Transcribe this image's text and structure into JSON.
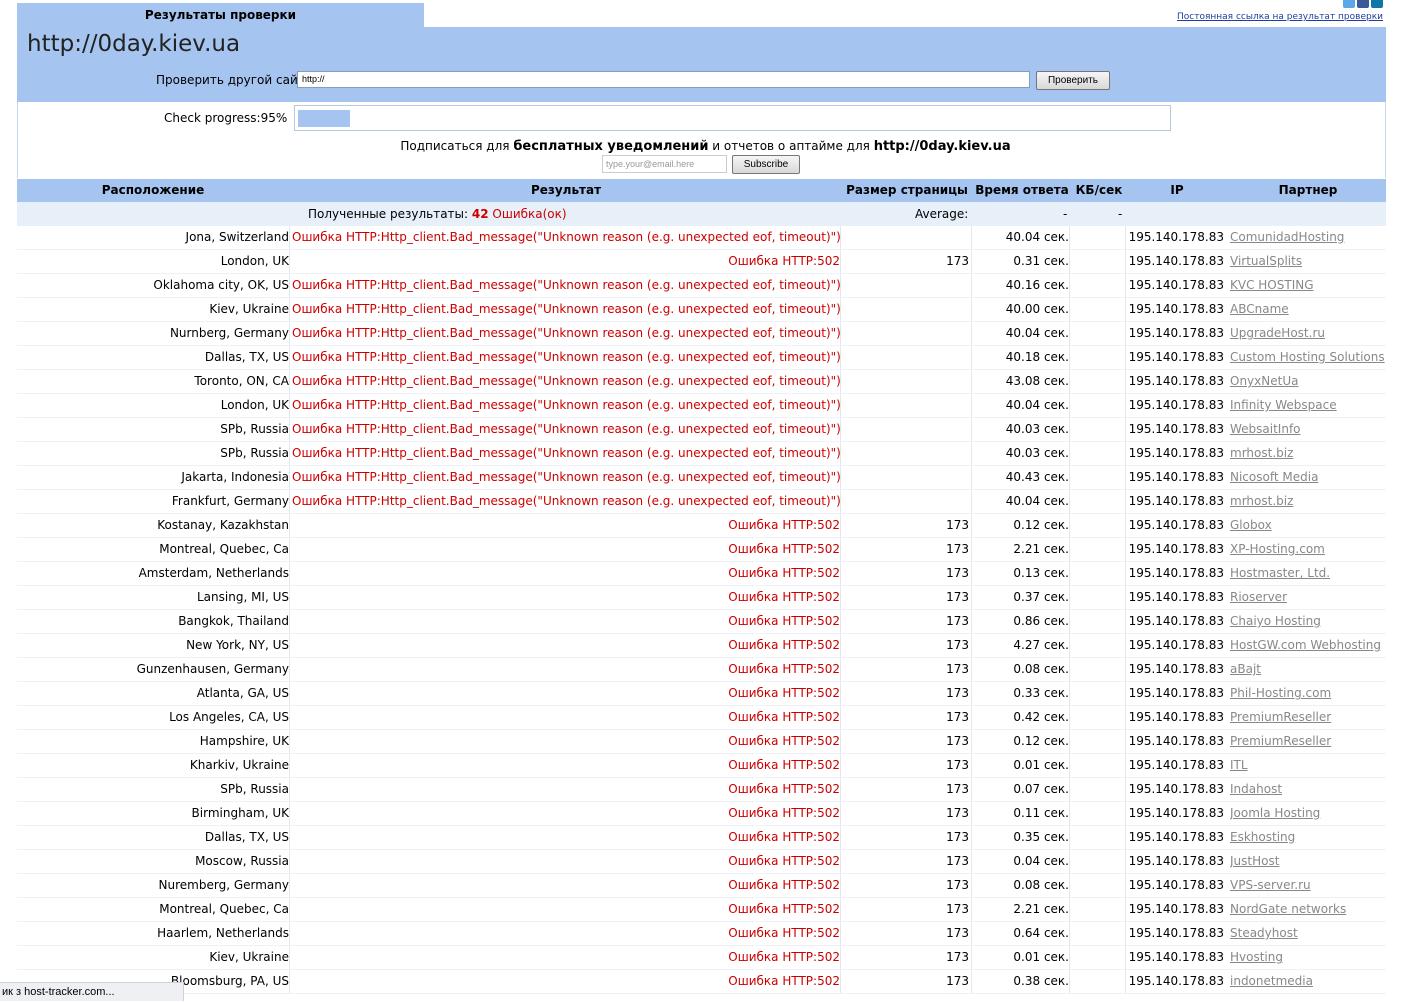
{
  "social": {
    "colors": [
      "#5aa9e6",
      "#3b5998",
      "#0e76a8"
    ]
  },
  "permalink_label": "Постоянная ссылка на результат проверки",
  "tab_label": "Результаты проверки",
  "site_title": "http://0day.kiev.ua",
  "check_label": "Проверить другой сайт:",
  "url_value": "http://",
  "check_button": "Проверить",
  "progress": {
    "label": "Check progress:95%",
    "percent": 95
  },
  "subscribe": {
    "text1": "Подписаться для ",
    "bold1": "бесплатных уведомлений",
    "text2": " и отчетов о аптайме для ",
    "bold2": "http://0day.kiev.ua",
    "email_placeholder": "type.your@email.here",
    "button": "Subscribe"
  },
  "columns": {
    "location": "Расположение",
    "result": "Результат",
    "size": "Размер страницы",
    "time": "Время ответа",
    "kb": "КБ/сек",
    "ip": "IP",
    "partner": "Партнер"
  },
  "summary": {
    "label": "Полученные результаты: ",
    "count": "42",
    "errors": " Ошибка(ок)",
    "average_label": "Average:",
    "avg_time": "-",
    "avg_kb": "-"
  },
  "rows": [
    {
      "loc": "Jona, Switzerland",
      "res": "Ошибка HTTP:Http_client.Bad_message(\"Unknown reason (e.g. unexpected eof, timeout)\")",
      "size": "",
      "time": "40.04 сек.",
      "ip": "195.140.178.83",
      "partner": "ComunidadHosting"
    },
    {
      "loc": "London, UK",
      "res": "Ошибка HTTP:502",
      "size": "173",
      "time": "0.31 сек.",
      "ip": "195.140.178.83",
      "partner": "VirtualSplits"
    },
    {
      "loc": "Oklahoma city, OK, US",
      "res": "Ошибка HTTP:Http_client.Bad_message(\"Unknown reason (e.g. unexpected eof, timeout)\")",
      "size": "",
      "time": "40.16 сек.",
      "ip": "195.140.178.83",
      "partner": "KVC HOSTING"
    },
    {
      "loc": "Kiev, Ukraine",
      "res": "Ошибка HTTP:Http_client.Bad_message(\"Unknown reason (e.g. unexpected eof, timeout)\")",
      "size": "",
      "time": "40.00 сек.",
      "ip": "195.140.178.83",
      "partner": "ABCname"
    },
    {
      "loc": "Nurnberg, Germany",
      "res": "Ошибка HTTP:Http_client.Bad_message(\"Unknown reason (e.g. unexpected eof, timeout)\")",
      "size": "",
      "time": "40.04 сек.",
      "ip": "195.140.178.83",
      "partner": "UpgradeHost.ru"
    },
    {
      "loc": "Dallas, TX, US",
      "res": "Ошибка HTTP:Http_client.Bad_message(\"Unknown reason (e.g. unexpected eof, timeout)\")",
      "size": "",
      "time": "40.18 сек.",
      "ip": "195.140.178.83",
      "partner": "Custom Hosting Solutions"
    },
    {
      "loc": "Toronto, ON, CA",
      "res": "Ошибка HTTP:Http_client.Bad_message(\"Unknown reason (e.g. unexpected eof, timeout)\")",
      "size": "",
      "time": "43.08 сек.",
      "ip": "195.140.178.83",
      "partner": "OnyxNetUa"
    },
    {
      "loc": "London, UK",
      "res": "Ошибка HTTP:Http_client.Bad_message(\"Unknown reason (e.g. unexpected eof, timeout)\")",
      "size": "",
      "time": "40.04 сек.",
      "ip": "195.140.178.83",
      "partner": "Infinity Webspace"
    },
    {
      "loc": "SPb, Russia",
      "res": "Ошибка HTTP:Http_client.Bad_message(\"Unknown reason (e.g. unexpected eof, timeout)\")",
      "size": "",
      "time": "40.03 сек.",
      "ip": "195.140.178.83",
      "partner": "WebsaitInfo"
    },
    {
      "loc": "SPb, Russia",
      "res": "Ошибка HTTP:Http_client.Bad_message(\"Unknown reason (e.g. unexpected eof, timeout)\")",
      "size": "",
      "time": "40.03 сек.",
      "ip": "195.140.178.83",
      "partner": "mrhost.biz"
    },
    {
      "loc": "Jakarta, Indonesia",
      "res": "Ошибка HTTP:Http_client.Bad_message(\"Unknown reason (e.g. unexpected eof, timeout)\")",
      "size": "",
      "time": "40.43 сек.",
      "ip": "195.140.178.83",
      "partner": "Nicosoft Media"
    },
    {
      "loc": "Frankfurt, Germany",
      "res": "Ошибка HTTP:Http_client.Bad_message(\"Unknown reason (e.g. unexpected eof, timeout)\")",
      "size": "",
      "time": "40.04 сек.",
      "ip": "195.140.178.83",
      "partner": "mrhost.biz"
    },
    {
      "loc": "Kostanay, Kazakhstan",
      "res": "Ошибка HTTP:502",
      "size": "173",
      "time": "0.12 сек.",
      "ip": "195.140.178.83",
      "partner": "Globox"
    },
    {
      "loc": "Montreal, Quebec, Ca",
      "res": "Ошибка HTTP:502",
      "size": "173",
      "time": "2.21 сек.",
      "ip": "195.140.178.83",
      "partner": "XP-Hosting.com"
    },
    {
      "loc": "Amsterdam, Netherlands",
      "res": "Ошибка HTTP:502",
      "size": "173",
      "time": "0.13 сек.",
      "ip": "195.140.178.83",
      "partner": "Hostmaster, Ltd."
    },
    {
      "loc": "Lansing, MI, US",
      "res": "Ошибка HTTP:502",
      "size": "173",
      "time": "0.37 сек.",
      "ip": "195.140.178.83",
      "partner": "Rioserver"
    },
    {
      "loc": "Bangkok, Thailand",
      "res": "Ошибка HTTP:502",
      "size": "173",
      "time": "0.86 сек.",
      "ip": "195.140.178.83",
      "partner": "Chaiyo Hosting"
    },
    {
      "loc": "New York, NY, US",
      "res": "Ошибка HTTP:502",
      "size": "173",
      "time": "4.27 сек.",
      "ip": "195.140.178.83",
      "partner": "HostGW.com Webhosting"
    },
    {
      "loc": "Gunzenhausen, Germany",
      "res": "Ошибка HTTP:502",
      "size": "173",
      "time": "0.08 сек.",
      "ip": "195.140.178.83",
      "partner": "aBajt"
    },
    {
      "loc": "Atlanta, GA, US",
      "res": "Ошибка HTTP:502",
      "size": "173",
      "time": "0.33 сек.",
      "ip": "195.140.178.83",
      "partner": "Phil-Hosting.com"
    },
    {
      "loc": "Los Angeles, CA, US",
      "res": "Ошибка HTTP:502",
      "size": "173",
      "time": "0.42 сек.",
      "ip": "195.140.178.83",
      "partner": "PremiumReseller"
    },
    {
      "loc": "Hampshire, UK",
      "res": "Ошибка HTTP:502",
      "size": "173",
      "time": "0.12 сек.",
      "ip": "195.140.178.83",
      "partner": "PremiumReseller"
    },
    {
      "loc": "Kharkiv, Ukraine",
      "res": "Ошибка HTTP:502",
      "size": "173",
      "time": "0.01 сек.",
      "ip": "195.140.178.83",
      "partner": "ITL"
    },
    {
      "loc": "SPb, Russia",
      "res": "Ошибка HTTP:502",
      "size": "173",
      "time": "0.07 сек.",
      "ip": "195.140.178.83",
      "partner": "Indahost"
    },
    {
      "loc": "Birmingham, UK",
      "res": "Ошибка HTTP:502",
      "size": "173",
      "time": "0.11 сек.",
      "ip": "195.140.178.83",
      "partner": "Joomla Hosting"
    },
    {
      "loc": "Dallas, TX, US",
      "res": "Ошибка HTTP:502",
      "size": "173",
      "time": "0.35 сек.",
      "ip": "195.140.178.83",
      "partner": "Eskhosting"
    },
    {
      "loc": "Moscow, Russia",
      "res": "Ошибка HTTP:502",
      "size": "173",
      "time": "0.04 сек.",
      "ip": "195.140.178.83",
      "partner": "JustHost"
    },
    {
      "loc": "Nuremberg, Germany",
      "res": "Ошибка HTTP:502",
      "size": "173",
      "time": "0.08 сек.",
      "ip": "195.140.178.83",
      "partner": "VPS-server.ru"
    },
    {
      "loc": "Montreal, Quebec, Ca",
      "res": "Ошибка HTTP:502",
      "size": "173",
      "time": "2.21 сек.",
      "ip": "195.140.178.83",
      "partner": "NordGate networks"
    },
    {
      "loc": "Haarlem, Netherlands",
      "res": "Ошибка HTTP:502",
      "size": "173",
      "time": "0.64 сек.",
      "ip": "195.140.178.83",
      "partner": "Steadyhost"
    },
    {
      "loc": "Kiev, Ukraine",
      "res": "Ошибка HTTP:502",
      "size": "173",
      "time": "0.01 сек.",
      "ip": "195.140.178.83",
      "partner": "Hvosting"
    },
    {
      "loc": "Bloomsburg, PA, US",
      "res": "Ошибка HTTP:502",
      "size": "173",
      "time": "0.38 сек.",
      "ip": "195.140.178.83",
      "partner": "indonetmedia"
    }
  ],
  "statusbar": "ик з host-tracker.com..."
}
